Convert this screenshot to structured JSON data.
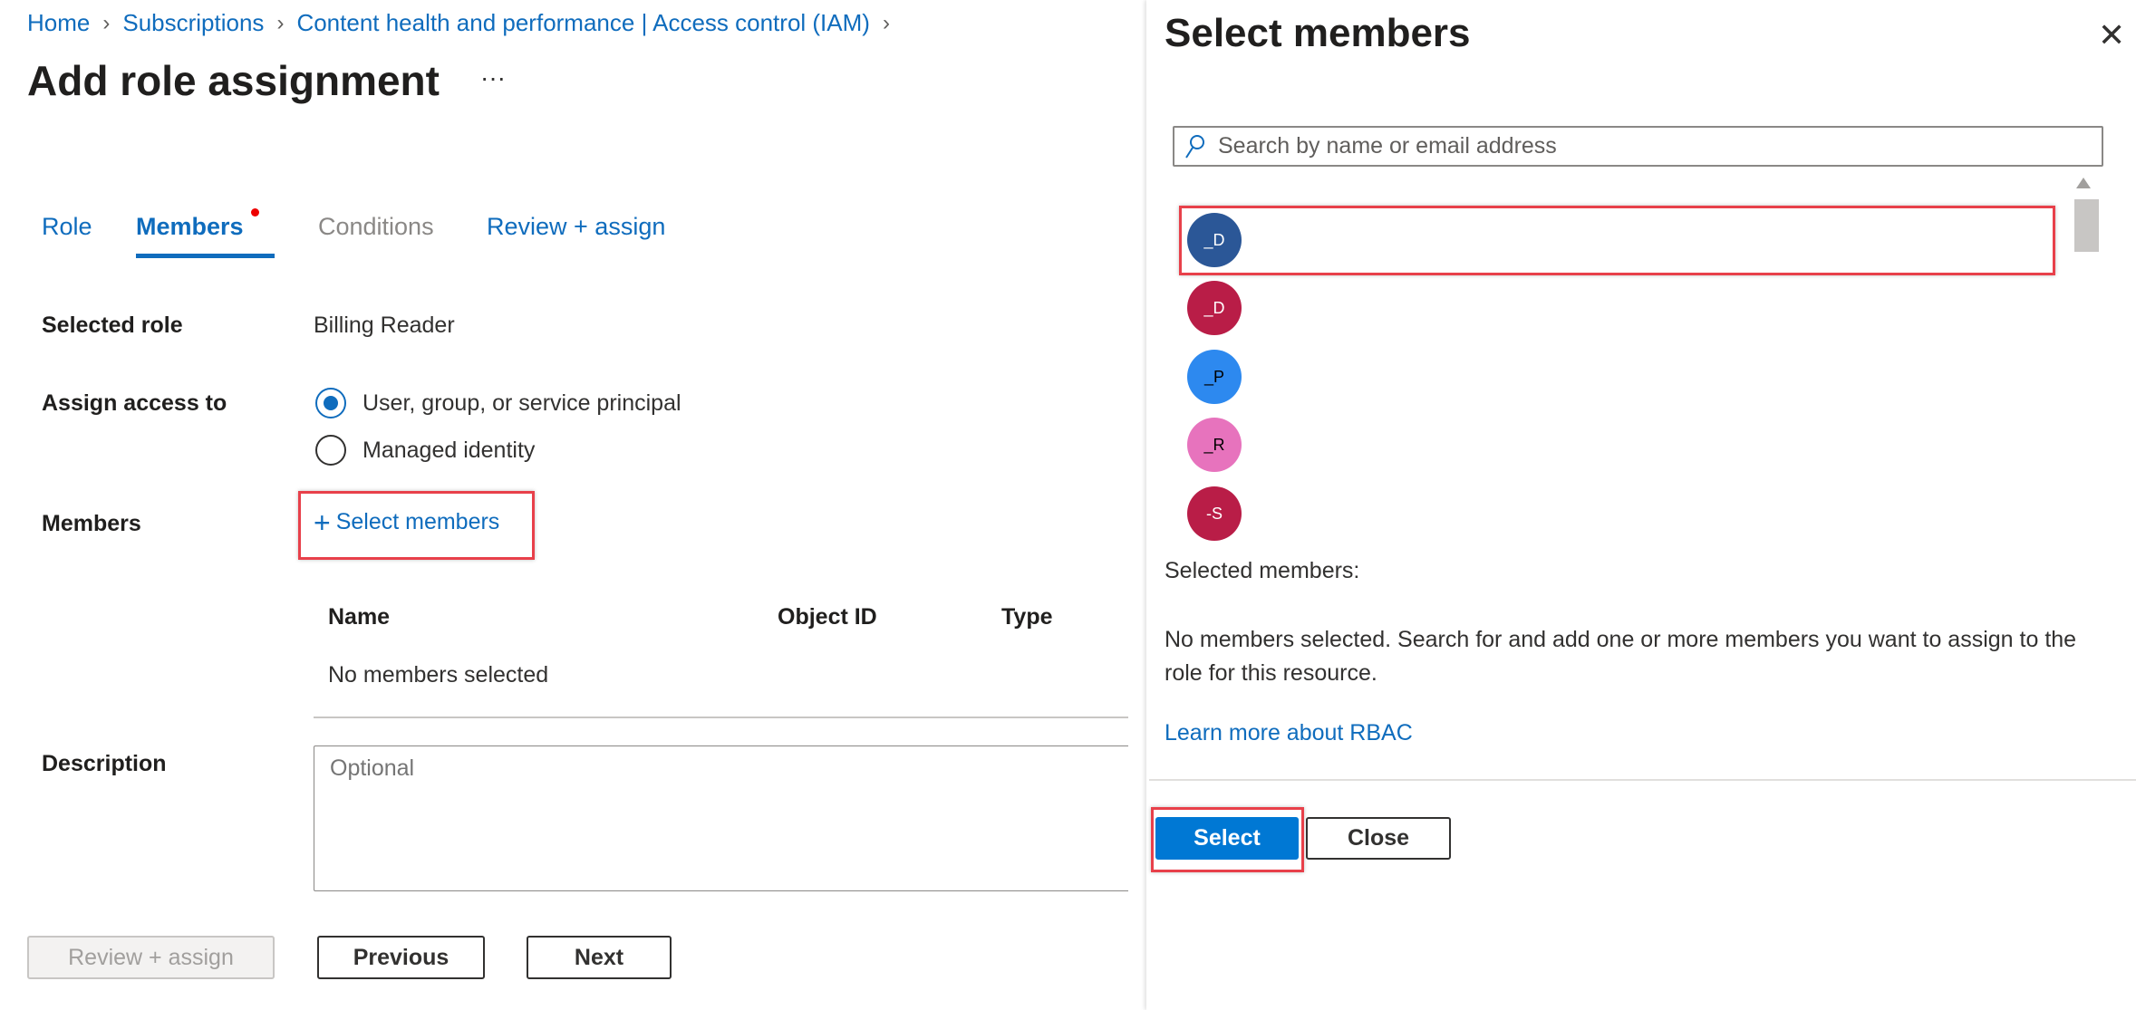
{
  "breadcrumb": [
    "Home",
    "Subscriptions",
    "Content health and performance | Access control (IAM)"
  ],
  "title": "Add role assignment",
  "more": "···",
  "tabs": [
    "Role",
    "Members",
    "Conditions",
    "Review + assign"
  ],
  "form": {
    "selected_role_label": "Selected role",
    "selected_role_value": "Billing Reader",
    "assign_label": "Assign access to",
    "assign_options": [
      "User, group, or service principal",
      "Managed identity"
    ],
    "members_label": "Members",
    "select_members": "Select members",
    "table_headers": [
      "Name",
      "Object ID",
      "Type"
    ],
    "table_empty": "No members selected",
    "description_label": "Description",
    "description_placeholder": "Optional"
  },
  "footer": {
    "review": "Review + assign",
    "previous": "Previous",
    "next": "Next"
  },
  "panel": {
    "title": "Select members",
    "search_placeholder": "Search by name or email address",
    "members": [
      {
        "initials": "_D",
        "color": "#2b5797"
      },
      {
        "initials": "_D",
        "color": "#b91d47"
      },
      {
        "initials": "_P",
        "color": "#2d89ef"
      },
      {
        "initials": "_R",
        "color": "#e773bd"
      },
      {
        "initials": "-S",
        "color": "#b91d47"
      }
    ],
    "selected_label": "Selected members:",
    "empty_text": "No members selected. Search for and add one or more members you want to assign to the role for this resource.",
    "learn_more": "Learn more about RBAC",
    "select": "Select",
    "close": "Close"
  }
}
